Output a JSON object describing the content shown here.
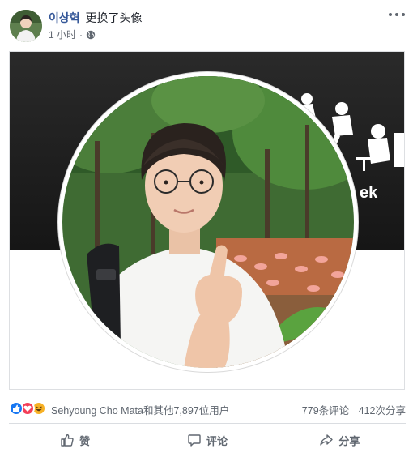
{
  "post": {
    "author": "이상혁",
    "action": "更换了头像",
    "time": "1 小时",
    "privacy_icon": "globe-icon"
  },
  "stats": {
    "reaction_icons": [
      "like-reaction-icon",
      "love-reaction-icon",
      "haha-reaction-icon"
    ],
    "reactors": "Sehyoung Cho Mata和其他7,897位用户",
    "comments": "779条评论",
    "shares": "412次分享"
  },
  "actions": {
    "like": "赞",
    "comment": "评论",
    "share": "分享"
  },
  "colors": {
    "author_link": "#365899",
    "like_blue": "#1877f2",
    "love_red": "#f33e58",
    "haha_yellow": "#f7b125"
  }
}
